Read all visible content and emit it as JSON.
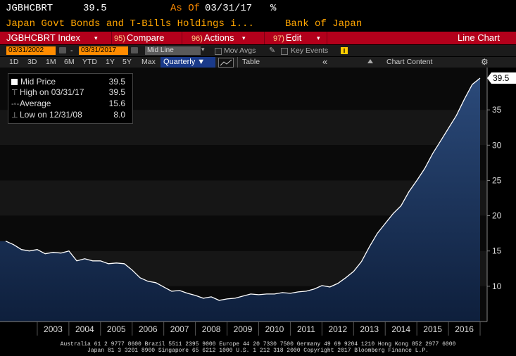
{
  "header": {
    "ticker": "JGBHCBRT",
    "last_value": "39.5",
    "as_of_label": "As Of",
    "as_of_date": "03/31/17",
    "unit": "%",
    "description": "Japan Govt Bonds and T-Bills Holdings i...",
    "source": "Bank of Japan"
  },
  "toolbar": {
    "security": "JGBHCBRT Index",
    "compare_num": "95)",
    "compare_label": "Compare",
    "actions_num": "96)",
    "actions_label": "Actions",
    "edit_num": "97)",
    "edit_label": "Edit",
    "chart_type": "Line Chart"
  },
  "date_range": {
    "start": "03/31/2002",
    "dash": "-",
    "end": "03/31/2017",
    "price_field": "Mid Line",
    "mov_avgs": "Mov Avgs",
    "key_events": "Key Events",
    "info": "i"
  },
  "periods": {
    "items": [
      "1D",
      "3D",
      "1M",
      "6M",
      "YTD",
      "1Y",
      "5Y",
      "Max"
    ],
    "frequency": "Quarterly ▼",
    "table": "Table",
    "chart_content": "Chart Content"
  },
  "legend": {
    "mid_label": "Mid Price",
    "mid_value": "39.5",
    "high_label": "High on 03/31/17",
    "high_value": "39.5",
    "avg_label": "Average",
    "avg_value": "15.6",
    "low_label": "Low on 12/31/08",
    "low_value": "8.0"
  },
  "colors": {
    "accent": "#ffa500",
    "command_bar": "#b3001b",
    "area_top": "#2b4a7a",
    "area_bottom": "#0e1f3c",
    "line": "#ffffff",
    "last_price_tag": "#ffffff"
  },
  "footer": {
    "line1": "Australia 61 2 9777 8600 Brazil 5511 2395 9000 Europe 44 20 7330 7500 Germany 49 69 9204 1210 Hong Kong 852 2977 6000",
    "line2": "Japan 81 3 3201 8900     Singapore 65 6212 1000     U.S. 1 212 318 2000     Copyright 2017 Bloomberg Finance L.P."
  },
  "chart_data": {
    "type": "area",
    "title": "",
    "xlabel": "",
    "ylabel": "",
    "ylim": [
      5,
      41
    ],
    "yticks": [
      10,
      15,
      20,
      25,
      30,
      35
    ],
    "last_price_tag": "39.5",
    "x_labels": [
      "2003",
      "2004",
      "2005",
      "2006",
      "2007",
      "2008",
      "2009",
      "2010",
      "2011",
      "2012",
      "2013",
      "2014",
      "2015",
      "2016"
    ],
    "series": [
      {
        "name": "Mid Price",
        "x": [
          2002.0,
          2002.25,
          2002.5,
          2002.75,
          2003.0,
          2003.25,
          2003.5,
          2003.75,
          2004.0,
          2004.25,
          2004.5,
          2004.75,
          2005.0,
          2005.25,
          2005.5,
          2005.75,
          2006.0,
          2006.25,
          2006.5,
          2006.75,
          2007.0,
          2007.25,
          2007.5,
          2007.75,
          2008.0,
          2008.25,
          2008.5,
          2008.75,
          2009.0,
          2009.25,
          2009.5,
          2009.75,
          2010.0,
          2010.25,
          2010.5,
          2010.75,
          2011.0,
          2011.25,
          2011.5,
          2011.75,
          2012.0,
          2012.25,
          2012.5,
          2012.75,
          2013.0,
          2013.25,
          2013.5,
          2013.75,
          2014.0,
          2014.25,
          2014.5,
          2014.75,
          2015.0,
          2015.25,
          2015.5,
          2015.75,
          2016.0,
          2016.25,
          2016.5,
          2016.75,
          2017.0
        ],
        "values": [
          16.4,
          15.9,
          15.2,
          15.0,
          15.2,
          14.6,
          14.8,
          14.7,
          15.0,
          13.6,
          13.9,
          13.6,
          13.6,
          13.2,
          13.3,
          13.2,
          12.3,
          11.2,
          10.7,
          10.5,
          9.9,
          9.3,
          9.4,
          9.0,
          8.7,
          8.3,
          8.5,
          8.0,
          8.2,
          8.3,
          8.6,
          8.9,
          8.8,
          8.9,
          8.9,
          9.1,
          9.0,
          9.2,
          9.3,
          9.6,
          10.1,
          9.9,
          10.4,
          11.2,
          12.1,
          13.5,
          15.6,
          17.5,
          18.9,
          20.3,
          21.4,
          23.4,
          25.0,
          26.7,
          28.8,
          30.6,
          32.4,
          34.2,
          36.5,
          38.6,
          39.5
        ]
      }
    ]
  }
}
